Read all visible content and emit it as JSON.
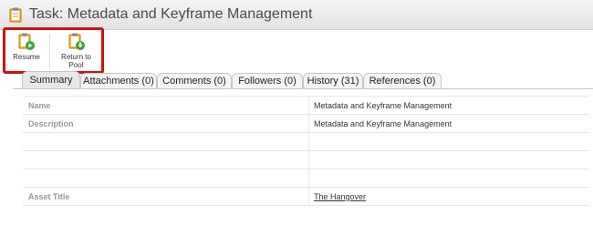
{
  "header": {
    "title": "Task: Metadata and Keyframe Management"
  },
  "toolbar": {
    "resume_label": "Resume",
    "return_label_line1": "Return to",
    "return_label_line2": "Pool"
  },
  "tabs": [
    {
      "label": "Summary"
    },
    {
      "label": "Attachments (0)"
    },
    {
      "label": "Comments (0)"
    },
    {
      "label": "Followers (0)"
    },
    {
      "label": "History (31)"
    },
    {
      "label": "References (0)"
    }
  ],
  "summary": {
    "rows": [
      {
        "key": "Name",
        "value": "Metadata and Keyframe Management"
      },
      {
        "key": "Description",
        "value": "Metadata and Keyframe Management"
      },
      {
        "key": "",
        "value": ""
      },
      {
        "key": "",
        "value": ""
      },
      {
        "key": "",
        "value": ""
      },
      {
        "key": "Asset Title",
        "value": "The Hangover"
      }
    ]
  },
  "colors": {
    "highlight": "#cc1111",
    "icon_orange": "#e8a020",
    "icon_green": "#3aa53a"
  }
}
